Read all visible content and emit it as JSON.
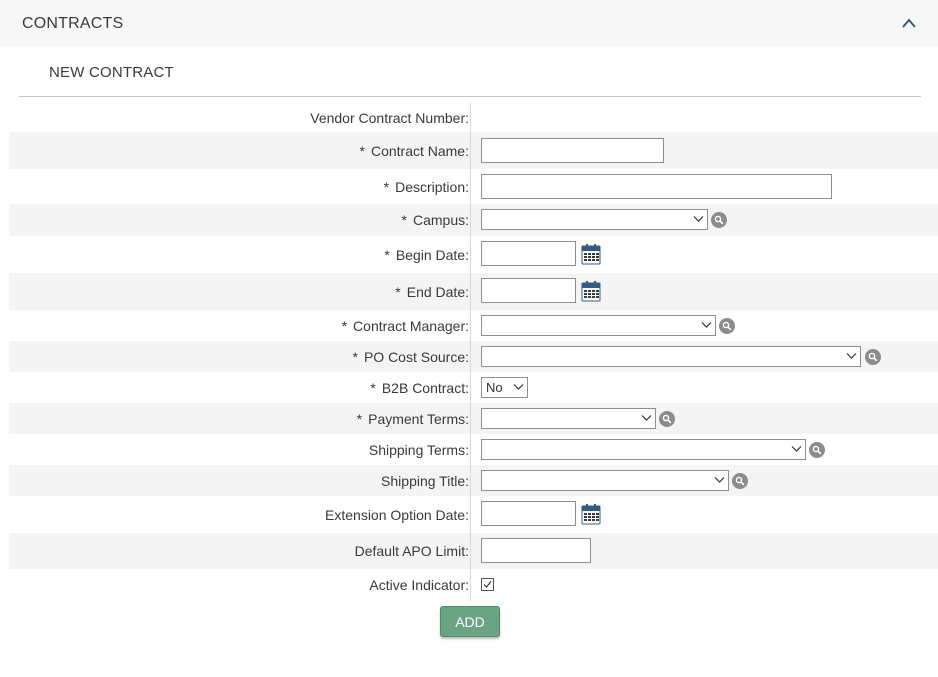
{
  "header": {
    "title": "CONTRACTS",
    "collapse_icon": "chevron-up-icon"
  },
  "subsection": {
    "title": "NEW CONTRACT"
  },
  "required_marker": "*",
  "form": {
    "vendor_contract_number": {
      "label": "Vendor Contract Number:",
      "value": ""
    },
    "contract_name": {
      "label": "Contract Name:",
      "value": ""
    },
    "description": {
      "label": "Description:",
      "value": ""
    },
    "campus": {
      "label": "Campus:",
      "value": ""
    },
    "begin_date": {
      "label": "Begin Date:",
      "value": ""
    },
    "end_date": {
      "label": "End Date:",
      "value": ""
    },
    "contract_manager": {
      "label": "Contract Manager:",
      "value": ""
    },
    "po_cost_source": {
      "label": "PO Cost Source:",
      "value": ""
    },
    "b2b_contract": {
      "label": "B2B Contract:",
      "value": "No"
    },
    "payment_terms": {
      "label": "Payment Terms:",
      "value": ""
    },
    "shipping_terms": {
      "label": "Shipping Terms:",
      "value": ""
    },
    "shipping_title": {
      "label": "Shipping Title:",
      "value": ""
    },
    "extension_option_date": {
      "label": "Extension Option Date:",
      "value": ""
    },
    "default_apo_limit": {
      "label": "Default APO Limit:",
      "value": ""
    },
    "active_indicator": {
      "label": "Active Indicator:",
      "checked": true
    }
  },
  "actions": {
    "add_label": "ADD"
  },
  "colors": {
    "button": "#6aa583",
    "lookup_icon": "#8c8c8c",
    "row_shade": "#f4f4f4",
    "calendar_icon": "#2c5d8c"
  }
}
